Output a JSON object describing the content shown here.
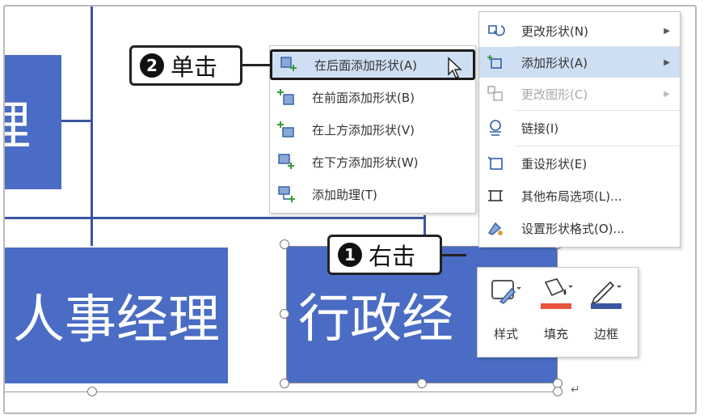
{
  "diagram": {
    "boxes": [
      {
        "name": "partial-box-top",
        "text": "理"
      },
      {
        "name": "hr-manager-box",
        "text": "人事经理"
      },
      {
        "name": "admin-manager-box",
        "text": "行政经"
      }
    ],
    "box_color": "#4a6cc4",
    "line_color": "#3b55a0"
  },
  "context_menu": {
    "items": [
      {
        "label": "更改形状(N)",
        "icon": "change-shape-icon",
        "has_submenu": true,
        "disabled": false
      },
      {
        "label": "添加形状(A)",
        "icon": "add-shape-icon",
        "has_submenu": true,
        "disabled": false,
        "highlighted": true
      },
      {
        "label": "更改图形(C)",
        "icon": "change-graphic-icon",
        "has_submenu": true,
        "disabled": true
      },
      {
        "label": "链接(I)",
        "icon": "link-icon",
        "has_submenu": false,
        "disabled": false
      },
      {
        "label": "重设形状(E)",
        "icon": "reset-shape-icon",
        "has_submenu": false,
        "disabled": false
      },
      {
        "label": "其他布局选项(L)...",
        "icon": "layout-options-icon",
        "has_submenu": false,
        "disabled": false
      },
      {
        "label": "设置形状格式(O)...",
        "icon": "format-shape-icon",
        "has_submenu": false,
        "disabled": false
      }
    ],
    "highlight_color": "#cfdff3"
  },
  "submenu": {
    "items": [
      {
        "label": "在后面添加形状(A)",
        "icon": "add-after-icon",
        "selected": true
      },
      {
        "label": "在前面添加形状(B)",
        "icon": "add-before-icon"
      },
      {
        "label": "在上方添加形状(V)",
        "icon": "add-above-icon"
      },
      {
        "label": "在下方添加形状(W)",
        "icon": "add-below-icon"
      },
      {
        "label": "添加助理(T)",
        "icon": "add-assistant-icon"
      }
    ]
  },
  "mini_toolbar": {
    "style_label": "样式",
    "fill_label": "填充",
    "border_label": "边框",
    "fill_color": "#e8533a",
    "border_color": "#3b55a0"
  },
  "callouts": {
    "step1": {
      "number": "1",
      "text": "右击"
    },
    "step2": {
      "number": "2",
      "text": "单击"
    }
  }
}
